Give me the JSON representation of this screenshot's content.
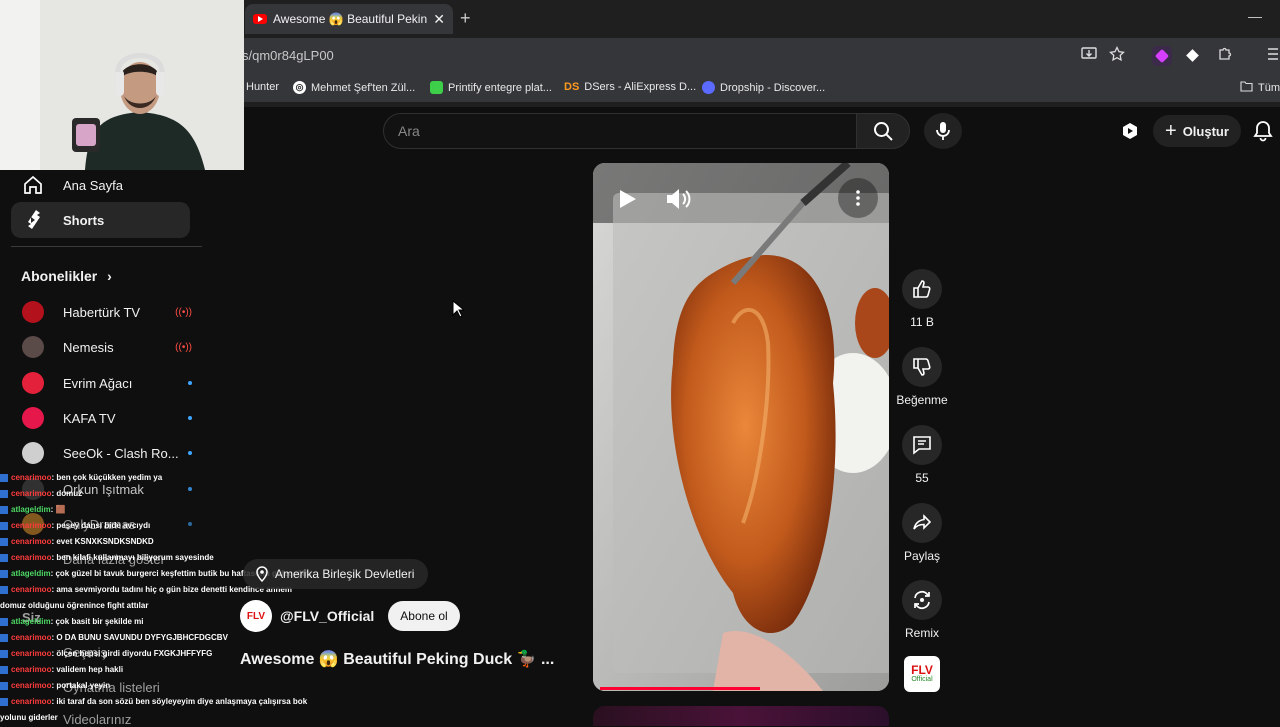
{
  "browser": {
    "tab_title": "Awesome 😱 Beautiful Peking",
    "tab_close": "✕",
    "new_tab": "+",
    "minimize": "—",
    "url": "s/qm0r84gLP00",
    "bookmarks": [
      {
        "label": "Hunter"
      },
      {
        "label": "Mehmet Şef'ten Zül..."
      },
      {
        "label": "Printify entegre plat..."
      },
      {
        "label": "DSers - AliExpress D...",
        "icon_text": "DS"
      },
      {
        "label": "Dropship - Discover..."
      },
      {
        "label": "Tüm"
      }
    ],
    "icons": [
      "install-icon",
      "star-icon",
      "extension-purple-icon",
      "diamond-icon",
      "puzzle-icon",
      "bookmarks-bar-icon"
    ]
  },
  "header": {
    "search_placeholder": "Ara",
    "create_label": "Oluştur"
  },
  "sidebar": {
    "items": [
      {
        "label": "Ana Sayfa",
        "icon": "home-icon"
      },
      {
        "label": "Shorts",
        "icon": "shorts-icon",
        "active": true
      }
    ],
    "subscriptions_title": "Abonelikler",
    "subscriptions_chevron": "›",
    "subscriptions": [
      {
        "name": "Habertürk TV",
        "badge": "live",
        "color": "#b3121c"
      },
      {
        "name": "Nemesis",
        "badge": "live",
        "color": "#5a4a48"
      },
      {
        "name": "Evrim Ağacı",
        "badge": "dot",
        "color": "#e4213a"
      },
      {
        "name": "KAFA TV",
        "badge": "dot",
        "color": "#e6174a"
      },
      {
        "name": "SeeOk - Clash Ro...",
        "badge": "dot",
        "color": "#cfcfcf"
      },
      {
        "name": "Orkun Işıtmak",
        "badge": "dot",
        "color": "#3a3a3a"
      },
      {
        "name": "OnlyDramas",
        "badge": "dot",
        "color": "#d08a2a"
      }
    ],
    "more_label": "Daha fazla göster",
    "you_label": "Siz",
    "history_label": "Geçmiş",
    "playlists_label": "Oynatma listeleri",
    "your_videos_label": "Videolarınız"
  },
  "chat": [
    {
      "user": "cenarimoo",
      "msg": ": ben çok küçükken yedim ya",
      "green": false
    },
    {
      "user": "cenarimoo",
      "msg": ": domuz",
      "green": false
    },
    {
      "user": "atlageldim",
      "msg": ": 🟫",
      "green": true
    },
    {
      "user": "cenarimoo",
      "msg": ": peşey dansı bide avcıydı",
      "green": false
    },
    {
      "user": "cenarimoo",
      "msg": ": evet KSNXKSNDKSNDKD",
      "green": false
    },
    {
      "user": "cenarimoo",
      "msg": ": ben kilafi kullanmayı biliyorum sayesinde",
      "green": false
    },
    {
      "user": "atlageldim",
      "msg": ": çok güzel bi tavuk burgerci keşfettim butik bu haftasonu gideceğim",
      "green": true
    },
    {
      "user": "cenarimoo",
      "msg": ": ama sevmiyordu tadını hiç o gün bize denetti kendince annem",
      "green": false
    },
    {
      "user": "",
      "msg": "domuz olduğunu öğrenince fight attılar",
      "green": false
    },
    {
      "user": "atlageldim",
      "msg": ": çok basit bir şekilde mi",
      "green": true
    },
    {
      "user": "cenarimoo",
      "msg": ": O DA BUNU SAVUNDU DYFYGJBHCFDGCBV",
      "green": false
    },
    {
      "user": "cenarimoo",
      "msg": ": ölçen hepsi girdi diyordu FXGKJHFFYFG",
      "green": false
    },
    {
      "user": "cenarimoo",
      "msg": ": validem hep hakli",
      "green": false
    },
    {
      "user": "cenarimoo",
      "msg": ": portakal yeyin",
      "green": false
    },
    {
      "user": "cenarimoo",
      "msg": ": iki taraf da son sözü ben söyleyeyim diye anlaşmaya çalışırsa bok",
      "green": false
    },
    {
      "user": "",
      "msg": "yolunu giderler",
      "green": false
    }
  ],
  "video": {
    "progress_fraction": 0.54
  },
  "actions": {
    "like_count": "11 B",
    "dislike_label": "Beğenme",
    "comment_count": "55",
    "share_label": "Paylaş",
    "remix_label": "Remix"
  },
  "overlay": {
    "location": "Amerika Birleşik Devletleri",
    "channel": "@FLV_Official",
    "subscribe": "Abone ol",
    "title": "Awesome 😱 Beautiful Peking Duck 🦆 ...",
    "logo_text": "FLV",
    "logo_sub": "Official"
  },
  "colors": {
    "accent_red": "#ff0033",
    "live_red": "#ff4e45",
    "chat_user": "#ff3c3c",
    "chat_user_alt": "#4cd964"
  }
}
